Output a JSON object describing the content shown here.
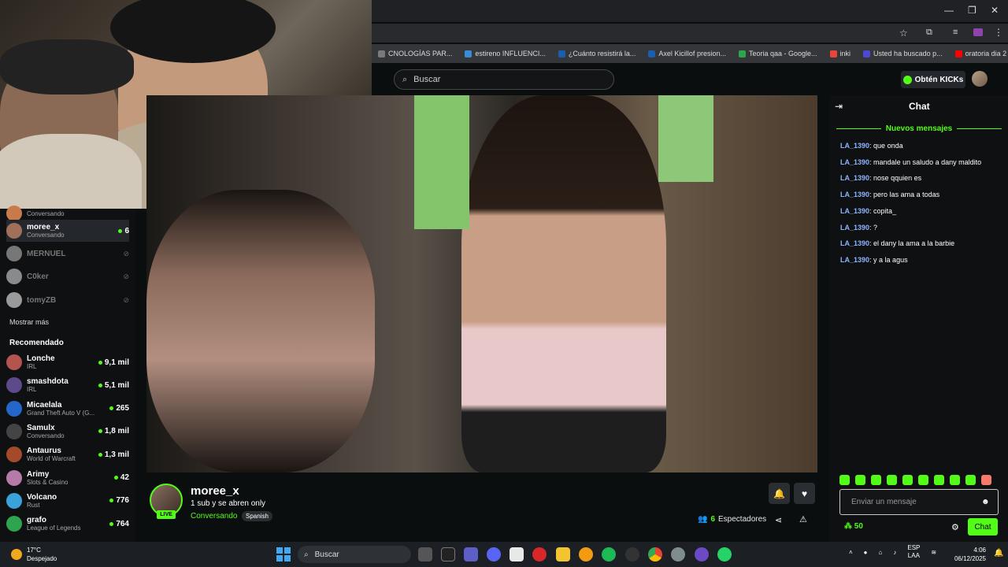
{
  "browser": {
    "bookmarks": [
      {
        "label": "CNOLOGÍAS PAR...",
        "color": "#7a7a7a"
      },
      {
        "label": "estireno INFLUENCI...",
        "color": "#3a8cd6"
      },
      {
        "label": "¿Cuánto resistirá la...",
        "color": "#1a5fae",
        "tag": "LN"
      },
      {
        "label": "Axel Kicillof presion...",
        "color": "#1a5fae",
        "tag": "LN"
      },
      {
        "label": "Teoria qaa - Google...",
        "color": "#2da44e"
      },
      {
        "label": "inki",
        "color": "#e8453c"
      },
      {
        "label": "Usted ha buscado p...",
        "color": "#4a4ad6"
      },
      {
        "label": "oratoria dia 2 TNC:1...",
        "color": "#ff0000"
      }
    ],
    "overflow": "»"
  },
  "header": {
    "search_placeholder": "Buscar",
    "kicks_label": "Obtén KICKs"
  },
  "sidebar": {
    "following": [
      {
        "name": "",
        "category": "Conversando",
        "count": ""
      },
      {
        "name": "moree_x",
        "category": "Conversando",
        "count": "6",
        "active": true
      },
      {
        "name": "MERNUEL",
        "category": "",
        "count": "",
        "offline": true
      },
      {
        "name": "C0ker",
        "category": "",
        "count": "",
        "offline": true
      },
      {
        "name": "tomyZB",
        "category": "",
        "count": "",
        "offline": true
      }
    ],
    "show_more": "Mostrar más",
    "recommended_heading": "Recomendado",
    "recommended": [
      {
        "name": "Lonche",
        "category": "IRL",
        "count": "9,1 mil"
      },
      {
        "name": "smashdota",
        "category": "IRL",
        "count": "5,1 mil"
      },
      {
        "name": "Micaelala",
        "category": "Grand Theft Auto V (G...",
        "count": "265"
      },
      {
        "name": "Samulx",
        "category": "Conversando",
        "count": "1,8 mil"
      },
      {
        "name": "Antaurus",
        "category": "World of Warcraft",
        "count": "1,3 mil"
      },
      {
        "name": "Arimy",
        "category": "Slots & Casino",
        "count": "42"
      },
      {
        "name": "Volcano",
        "category": "Rust",
        "count": "776"
      },
      {
        "name": "grafo",
        "category": "League of Legends",
        "count": "764"
      }
    ]
  },
  "stream": {
    "streamer": "moree_x",
    "title": "1 sub y se abren only",
    "category": "Conversando",
    "language": "Spanish",
    "live": "LIVE",
    "viewers": "6",
    "viewers_label": "Espectadores"
  },
  "chat": {
    "title": "Chat",
    "new_messages": "Nuevos mensajes",
    "messages": [
      {
        "user": "LA_1390",
        "text": "que onda"
      },
      {
        "user": "LA_1390",
        "text": "mandale un saludo a dany maldito"
      },
      {
        "user": "LA_1390",
        "text": "nose qquien es"
      },
      {
        "user": "LA_1390",
        "text": "pero las ama a todas"
      },
      {
        "user": "LA_1390",
        "text": "copita_"
      },
      {
        "user": "LA_1390",
        "text": "?"
      },
      {
        "user": "LA_1390",
        "text": "el dany la ama a la barbie"
      },
      {
        "user": "LA_1390",
        "text": "y a la agus"
      }
    ],
    "input_placeholder": "Enviar un mensaje",
    "points": "50",
    "send_label": "Chat"
  },
  "taskbar": {
    "temperature": "17°C",
    "weather": "Despejado",
    "search": "Buscar",
    "lang_top": "ESP",
    "lang_bottom": "LAA",
    "time": "4:06",
    "date": "06/12/2025"
  },
  "colors": {
    "accent": "#53fc18",
    "username": "#8db4ff"
  }
}
